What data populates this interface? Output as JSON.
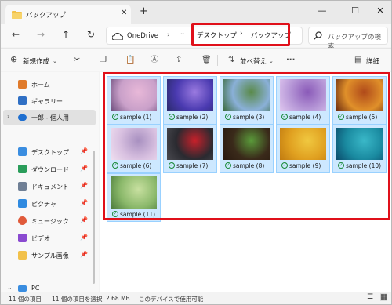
{
  "tab": {
    "title": "バックアップ",
    "close": "✕",
    "new": "+"
  },
  "window_controls": {
    "minimize": "—",
    "maximize": "☐",
    "close": "✕"
  },
  "nav": {
    "back": "←",
    "forward": "→",
    "up": "↑",
    "refresh": "↻"
  },
  "address": {
    "root": "OneDrive",
    "ellipsis": "···",
    "crumbs": [
      "デスクトップ",
      "バックアップ"
    ],
    "separator": "›"
  },
  "search": {
    "placeholder": "バックアップの検索"
  },
  "toolbar": {
    "new_label": "新規作成",
    "sort_label": "並べ替え",
    "more": "···",
    "details_label": "詳細"
  },
  "sidebar": {
    "items": [
      {
        "label": "ホーム",
        "icon": "home-icon",
        "color": "#e07a2a"
      },
      {
        "label": "ギャラリー",
        "icon": "gallery-icon",
        "color": "#2f6fc4"
      },
      {
        "label": "一郎 - 個人用",
        "icon": "onedrive-cloud-icon",
        "color": "#1f6fd0"
      },
      {
        "label": "デスクトップ",
        "icon": "desktop-icon",
        "color": "#3a8de0"
      },
      {
        "label": "ダウンロード",
        "icon": "download-icon",
        "color": "#2a9d5a"
      },
      {
        "label": "ドキュメント",
        "icon": "documents-icon",
        "color": "#6f7f95"
      },
      {
        "label": "ピクチャ",
        "icon": "pictures-icon",
        "color": "#2f8ae0"
      },
      {
        "label": "ミュージック",
        "icon": "music-icon",
        "color": "#e05a3a"
      },
      {
        "label": "ビデオ",
        "icon": "videos-icon",
        "color": "#8a4ad0"
      },
      {
        "label": "サンプル画像",
        "icon": "folder-icon",
        "color": "#f2c14a"
      },
      {
        "label": "PC",
        "icon": "pc-icon",
        "color": "#3a8de0"
      }
    ]
  },
  "files": [
    {
      "name": "sample (1)",
      "colors": [
        "#c9a0c9",
        "#e8b8d8",
        "#6a4a7a"
      ]
    },
    {
      "name": "sample (2)",
      "colors": [
        "#4a3ab0",
        "#9a7ae0",
        "#2a2a6a"
      ]
    },
    {
      "name": "sample (3)",
      "colors": [
        "#8ab0d8",
        "#5a8a4a",
        "#3a6a3a"
      ]
    },
    {
      "name": "sample (4)",
      "colors": [
        "#b89ad8",
        "#8a5ab8",
        "#e0c8f0"
      ]
    },
    {
      "name": "sample (5)",
      "colors": [
        "#e0902a",
        "#b04a1a",
        "#6a2a10"
      ]
    },
    {
      "name": "sample (6)",
      "colors": [
        "#d8c0e0",
        "#a890c0",
        "#f0e0f0"
      ]
    },
    {
      "name": "sample (7)",
      "colors": [
        "#2a2a30",
        "#c8202a",
        "#4a4a50"
      ]
    },
    {
      "name": "sample (8)",
      "colors": [
        "#3a2a1a",
        "#5a9a3a",
        "#2a1a10"
      ]
    },
    {
      "name": "sample (9)",
      "colors": [
        "#e0a020",
        "#f0c840",
        "#c07a10"
      ]
    },
    {
      "name": "sample (10)",
      "colors": [
        "#1a8aa0",
        "#3ab8c8",
        "#0a4a6a"
      ]
    },
    {
      "name": "sample (11)",
      "colors": [
        "#8ab86a",
        "#c8e0a0",
        "#4a7a3a"
      ]
    }
  ],
  "status": {
    "count": "11 個の項目",
    "selected": "11 個の項目を選択",
    "size": "2.68 MB",
    "availability": "このデバイスで使用可能"
  }
}
